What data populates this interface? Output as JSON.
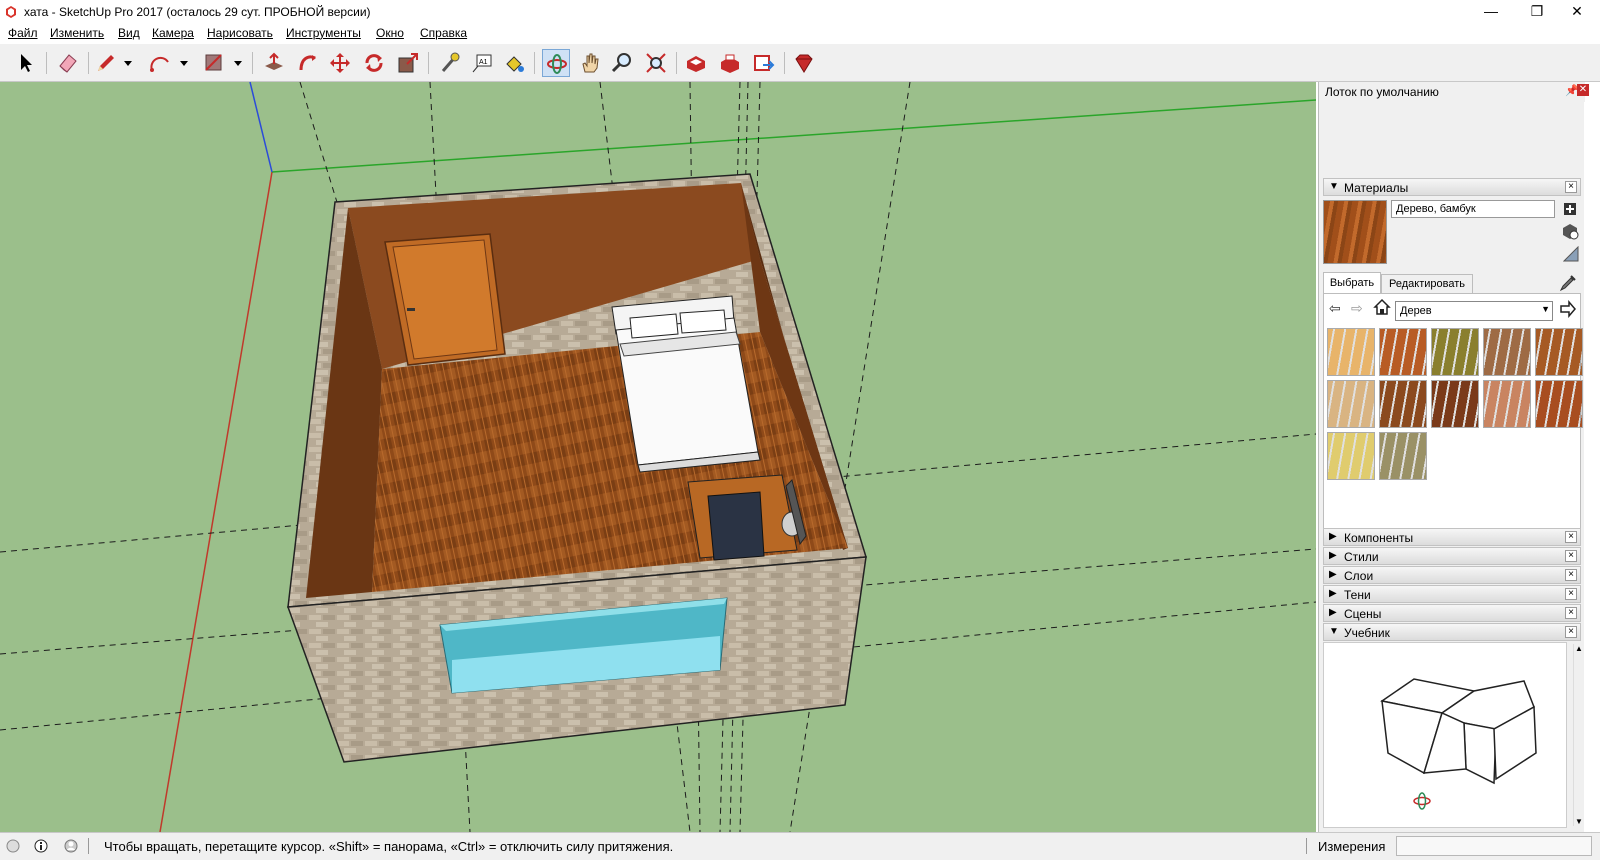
{
  "window": {
    "title": "хата - SketchUp Pro 2017 (осталось 29 сут. ПРОБНОЙ версии)",
    "minimize": "—",
    "restore": "❐",
    "close": "✕"
  },
  "menu": [
    "Файл",
    "Изменить",
    "Вид",
    "Камера",
    "Нарисовать",
    "Инструменты",
    "Окно",
    "Справка"
  ],
  "toolbar": {
    "tools": [
      "select-icon",
      "eraser-icon",
      "pencil-icon",
      "arc-icon",
      "rectangle-icon",
      "push-pull-icon",
      "follow-me-icon",
      "move-icon",
      "rotate-icon",
      "scale-icon",
      "tape-measure-icon",
      "text-icon",
      "paint-bucket-icon",
      "orbit-icon",
      "pan-icon",
      "zoom-icon",
      "zoom-extents-icon",
      "3d-warehouse-icon",
      "extension-warehouse-icon",
      "send-to-layout-icon",
      "ruby-icon"
    ],
    "text_tool_label": "A1"
  },
  "tray": {
    "title": "Лоток по умолчанию",
    "materials": {
      "header": "Материалы",
      "material_name": "Дерево, бамбук",
      "tab_select": "Выбрать",
      "tab_edit": "Редактировать",
      "library": "Дерев",
      "swatch_colors": [
        "#e8b46a",
        "#b85c25",
        "#8a7f2e",
        "#9e6b45",
        "#a65a24",
        "#d9b482",
        "#8b4a1f",
        "#7a3a1a",
        "#c98461",
        "#a84d20",
        "#e0cc6e",
        "#9a9166"
      ]
    },
    "panels": [
      "Компоненты",
      "Стили",
      "Слои",
      "Тени",
      "Сцены"
    ],
    "tutorial_header": "Учебник"
  },
  "status": {
    "message": "Чтобы вращать, перетащите курсор. «Shift» = панорама, «Ctrl» = отключить силу притяжения.",
    "measurements_label": "Измерения",
    "measurements_value": ""
  }
}
